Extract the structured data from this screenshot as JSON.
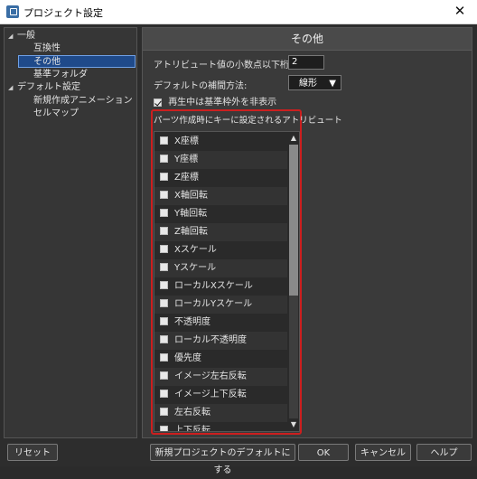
{
  "window": {
    "title": "プロジェクト設定",
    "close_glyph": "✕"
  },
  "tree": {
    "items": [
      {
        "label": "一般",
        "level": 0,
        "expanded": true,
        "selected": false
      },
      {
        "label": "互換性",
        "level": 1,
        "selected": false
      },
      {
        "label": "その他",
        "level": 1,
        "selected": true
      },
      {
        "label": "基準フォルダ",
        "level": 1,
        "selected": false
      },
      {
        "label": "デフォルト設定",
        "level": 0,
        "expanded": true,
        "selected": false
      },
      {
        "label": "新規作成アニメーション",
        "level": 1,
        "selected": false
      },
      {
        "label": "セルマップ",
        "level": 1,
        "selected": false
      }
    ]
  },
  "panel": {
    "header": "その他",
    "decimal_label": "アトリビュート値の小数点以下桁数:",
    "decimal_value": "2",
    "interp_label": "デフォルトの補間方法:",
    "interp_value": "線形",
    "hide_ref_frame_label": "再生中は基準枠外を非表示",
    "hide_ref_frame_checked": true,
    "attr_group_label": "パーツ作成時にキーに設定されるアトリビュート",
    "attributes": [
      {
        "label": "X座標",
        "checked": false
      },
      {
        "label": "Y座標",
        "checked": false
      },
      {
        "label": "Z座標",
        "checked": false
      },
      {
        "label": "X軸回転",
        "checked": false
      },
      {
        "label": "Y軸回転",
        "checked": false
      },
      {
        "label": "Z軸回転",
        "checked": false
      },
      {
        "label": "Xスケール",
        "checked": false
      },
      {
        "label": "Yスケール",
        "checked": false
      },
      {
        "label": "ローカルXスケール",
        "checked": false
      },
      {
        "label": "ローカルYスケール",
        "checked": false
      },
      {
        "label": "不透明度",
        "checked": false
      },
      {
        "label": "ローカル不透明度",
        "checked": false
      },
      {
        "label": "優先度",
        "checked": false
      },
      {
        "label": "イメージ左右反転",
        "checked": false
      },
      {
        "label": "イメージ上下反転",
        "checked": false
      },
      {
        "label": "左右反転",
        "checked": false
      },
      {
        "label": "上下反転",
        "checked": false
      }
    ],
    "scroll_position": 0.0,
    "scroll_visible_fraction": 0.55
  },
  "footer": {
    "reset": "リセット",
    "set_default": "新規プロジェクトのデフォルトにする",
    "ok": "OK",
    "cancel": "キャンセル",
    "help": "ヘルプ"
  },
  "colors": {
    "accent": "#cc1f1f",
    "selection": "#1f4a8a"
  }
}
